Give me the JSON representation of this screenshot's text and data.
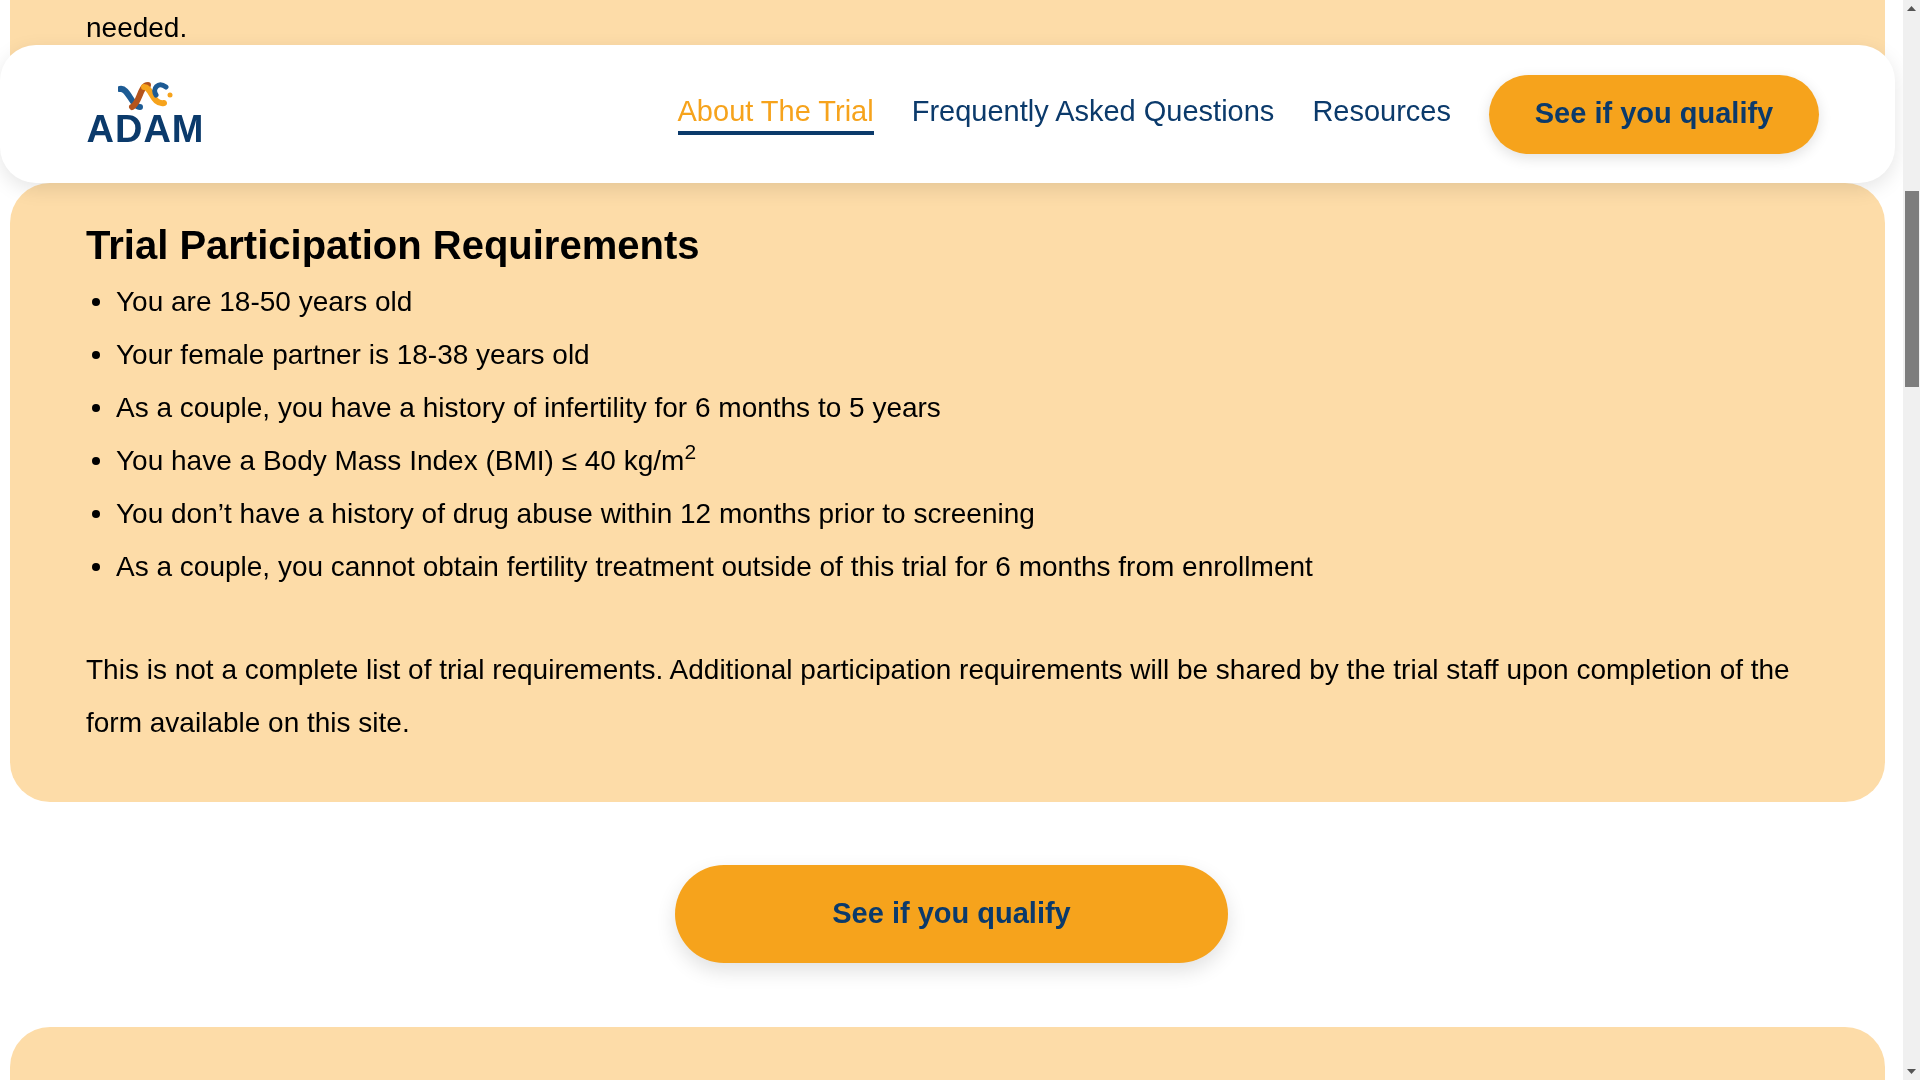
{
  "previous_section": {
    "text": "needed."
  },
  "nav": {
    "logo": "ADAM",
    "links": [
      {
        "label": "About The Trial",
        "selected": true
      },
      {
        "label": "Frequently Asked Questions",
        "selected": false
      },
      {
        "label": "Resources",
        "selected": false
      }
    ],
    "cta": "See if you qualify"
  },
  "requirements": {
    "title": "Trial Participation Requirements",
    "items": [
      "You are 18-50 years old",
      "Your female partner is 18-38 years old",
      "As a couple, you have a history of infertility for 6 months to 5 years",
      "You have a Body Mass Index (BMI) ≤ 40 kg/m$^{2}$",
      "You don’t have a history of drug abuse within 12 months prior to screening",
      "As a couple, you cannot obtain fertility treatment outside of this trial for 6 months from enrollment"
    ],
    "note": "This is not a complete list of trial requirements. Additional participation requirements will be shared by the trial staff upon completion of the form available on this site."
  },
  "cta_button": "See if you qualify"
}
